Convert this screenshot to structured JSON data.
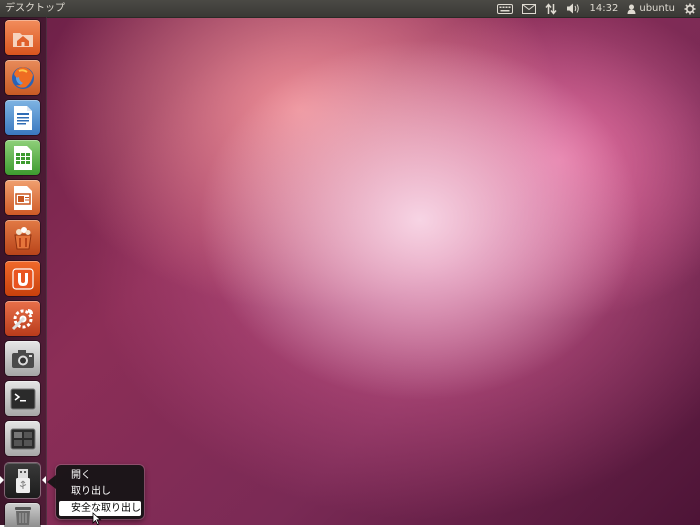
{
  "top_panel": {
    "title": "デスクトップ",
    "clock": "14:32",
    "user": "ubuntu"
  },
  "launcher": {
    "items": [
      {
        "name": "home-folder",
        "icon": "home-folder-icon"
      },
      {
        "name": "firefox",
        "icon": "firefox-icon"
      },
      {
        "name": "writer",
        "icon": "libreoffice-writer-icon"
      },
      {
        "name": "calc",
        "icon": "libreoffice-calc-icon"
      },
      {
        "name": "impress",
        "icon": "libreoffice-impress-icon"
      },
      {
        "name": "software-center",
        "icon": "software-center-icon"
      },
      {
        "name": "ubuntu-one",
        "icon": "ubuntu-one-icon"
      },
      {
        "name": "system-settings",
        "icon": "system-settings-icon"
      },
      {
        "name": "screenshot",
        "icon": "camera-icon"
      },
      {
        "name": "terminal",
        "icon": "terminal-icon"
      },
      {
        "name": "workspace-switcher",
        "icon": "workspace-switcher-icon"
      },
      {
        "name": "usb-drive",
        "icon": "usb-drive-icon"
      },
      {
        "name": "trash",
        "icon": "trash-icon"
      }
    ]
  },
  "quicklist": {
    "items": [
      {
        "label": "開く"
      },
      {
        "label": "取り出し"
      },
      {
        "label": "安全な取り出し",
        "selected": true
      }
    ]
  },
  "colors": {
    "panel": "#3c3b37",
    "accent": "#dd4814"
  }
}
